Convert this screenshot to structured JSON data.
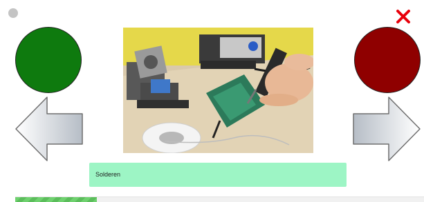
{
  "caption": {
    "text": "Solderen"
  },
  "controls": {
    "yes_color": "#0e7a0e",
    "no_color": "#8f0000",
    "close_color": "#e8000b",
    "arrow_gradient_light": "#ffffff",
    "arrow_gradient_dark": "#b6bdc6"
  },
  "icons": {
    "status": "circle-dot",
    "close": "close-x-icon",
    "previous": "arrow-left-icon",
    "next": "arrow-right-icon"
  },
  "progress": {
    "fraction": 0.2
  }
}
